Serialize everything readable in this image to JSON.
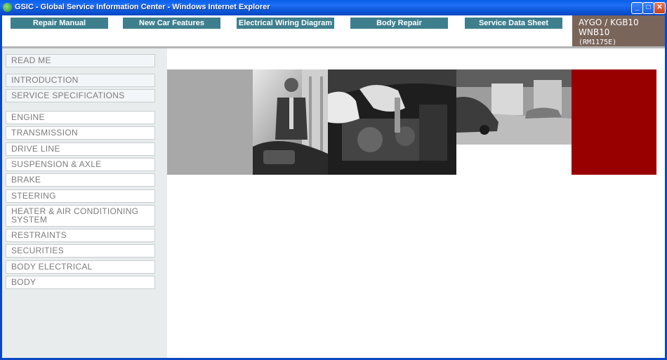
{
  "window": {
    "title": "GSIC - Global Service Information Center - Windows Internet Explorer",
    "controls": [
      "minimize",
      "maximize",
      "close"
    ]
  },
  "nav": {
    "buttons": [
      "Repair Manual",
      "New Car Features",
      "Electrical Wiring Diagram",
      "Body Repair",
      "Service Data Sheet"
    ]
  },
  "model": {
    "line1": "AYGO / KGB10",
    "line2": "WNB10",
    "code": "(RM1175E)"
  },
  "sidebar": {
    "items": [
      "READ ME",
      "INTRODUCTION",
      "SERVICE SPECIFICATIONS",
      "ENGINE",
      "TRANSMISSION",
      "DRIVE LINE",
      "SUSPENSION & AXLE",
      "BRAKE",
      "STEERING",
      "HEATER & AIR CONDITIONING SYSTEM",
      "RESTRAINTS",
      "SECURITIES",
      "BODY ELECTRICAL",
      "BODY"
    ]
  },
  "colors": {
    "nav_button": "#3e7f8e",
    "model_box": "#7a655b",
    "sidebar_bg": "#e8ecec",
    "banner_gray": "#a8a8a8",
    "banner_red": "#980000"
  }
}
